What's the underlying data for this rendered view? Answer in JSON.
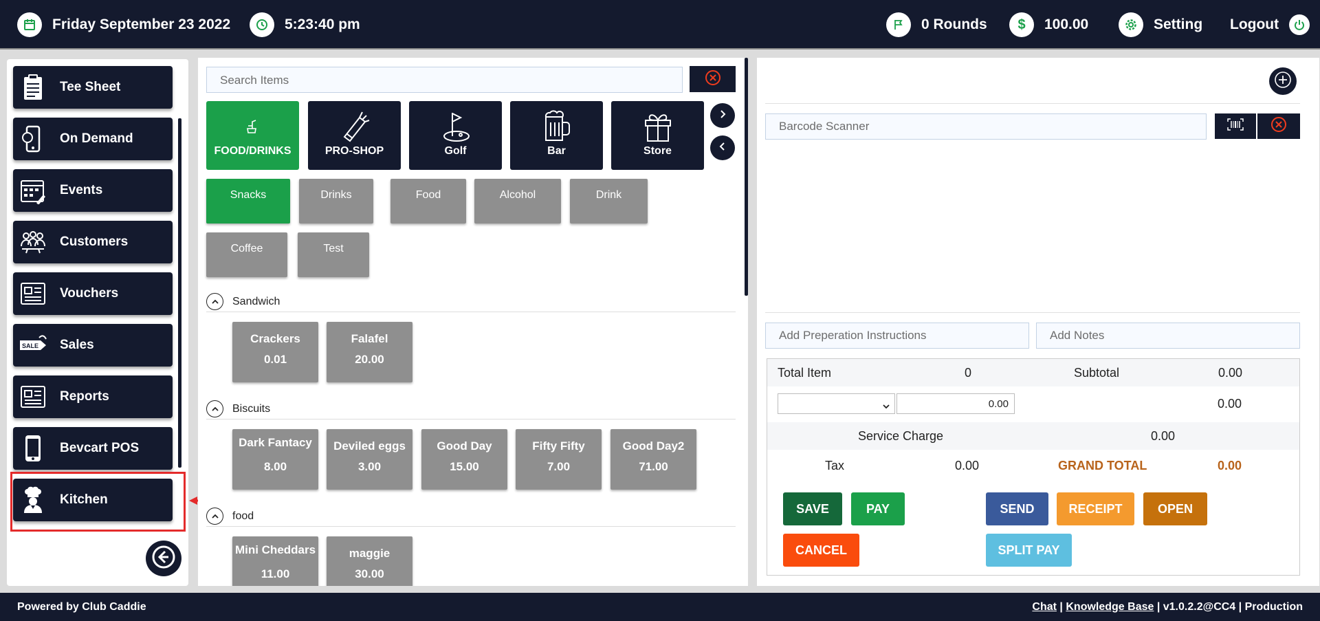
{
  "topbar": {
    "date": "Friday September 23 2022",
    "time": "5:23:40 pm",
    "rounds": "0 Rounds",
    "balance": "100.00",
    "setting": "Setting",
    "logout": "Logout"
  },
  "sidebar": {
    "items": [
      {
        "label": "Tee Sheet",
        "icon": "clipboard-icon"
      },
      {
        "label": "On Demand",
        "icon": "phone-icon"
      },
      {
        "label": "Events",
        "icon": "calendar-icon"
      },
      {
        "label": "Customers",
        "icon": "people-icon"
      },
      {
        "label": "Vouchers",
        "icon": "newspaper-icon"
      },
      {
        "label": "Sales",
        "icon": "sale-tag-icon"
      },
      {
        "label": "Reports",
        "icon": "newspaper-icon"
      },
      {
        "label": "Bevcart POS",
        "icon": "mobile-icon"
      },
      {
        "label": "Kitchen",
        "icon": "chef-icon"
      }
    ]
  },
  "center": {
    "search_placeholder": "Search Items",
    "categories": [
      {
        "label": "FOOD/DRINKS",
        "icon": "food-drinks-icon"
      },
      {
        "label": "PRO-SHOP",
        "icon": "golf-bag-icon"
      },
      {
        "label": "Golf",
        "icon": "golf-flag-icon"
      },
      {
        "label": "Bar",
        "icon": "beer-mug-icon"
      },
      {
        "label": "Store",
        "icon": "gift-icon"
      }
    ],
    "subcategories": [
      "Snacks",
      "Drinks",
      "Food",
      "Alcohol",
      "Drink",
      "Coffee",
      "Test"
    ],
    "sections": [
      {
        "title": "Sandwich",
        "items": [
          {
            "name": "Crackers",
            "price": "0.01"
          },
          {
            "name": "Falafel",
            "price": "20.00"
          }
        ]
      },
      {
        "title": "Biscuits",
        "items": [
          {
            "name": "Dark Fantacy",
            "price": "8.00"
          },
          {
            "name": "Deviled eggs",
            "price": "3.00"
          },
          {
            "name": "Good Day",
            "price": "15.00"
          },
          {
            "name": "Fifty Fifty",
            "price": "7.00"
          },
          {
            "name": "Good Day2",
            "price": "71.00"
          }
        ]
      },
      {
        "title": "food",
        "items": [
          {
            "name": "Mini Cheddars",
            "price": "11.00"
          },
          {
            "name": "maggie",
            "price": "30.00"
          }
        ]
      }
    ]
  },
  "right": {
    "barcode_placeholder": "Barcode Scanner",
    "prep_placeholder": "Add Preperation Instructions",
    "notes_placeholder": "Add Notes",
    "total_item_label": "Total Item",
    "total_item_value": "0",
    "subtotal_label": "Subtotal",
    "subtotal_value": "0.00",
    "discount_input": "0.00",
    "discount_value": "0.00",
    "service_charge_label": "Service Charge",
    "service_charge_value": "0.00",
    "tax_label": "Tax",
    "tax_value": "0.00",
    "grand_total_label": "GRAND TOTAL",
    "grand_total_value": "0.00",
    "buttons": {
      "save": "SAVE",
      "pay": "PAY",
      "send": "SEND",
      "receipt": "RECEIPT",
      "open": "OPEN",
      "cancel": "CANCEL",
      "split_pay": "SPLIT PAY"
    }
  },
  "footer": {
    "powered_by": "Powered by Club Caddie",
    "chat": "Chat",
    "sep1": " | ",
    "kb": "Knowledge Base",
    "version": " | v1.0.2.2@CC4 | Production"
  },
  "colors": {
    "navy": "#141a2e",
    "green": "#1ba04a",
    "gray": "#8f8f8f",
    "highlight": "#e42b2b",
    "grand_total": "#b8631b"
  }
}
